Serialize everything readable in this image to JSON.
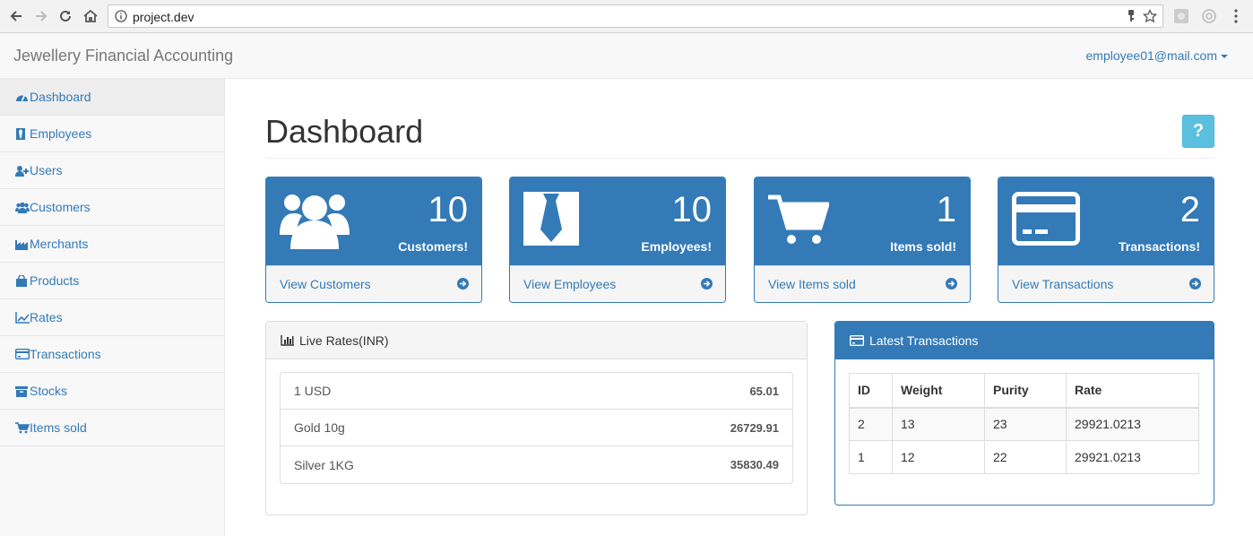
{
  "browser": {
    "url": "project.dev"
  },
  "app": {
    "brand": "Jewellery Financial Accounting",
    "user_email": "employee01@mail.com"
  },
  "sidebar": {
    "items": [
      {
        "label": "Dashboard",
        "icon": "dashboard-icon"
      },
      {
        "label": "Employees",
        "icon": "tie-icon"
      },
      {
        "label": "Users",
        "icon": "user-plus-icon"
      },
      {
        "label": "Customers",
        "icon": "users-icon"
      },
      {
        "label": "Merchants",
        "icon": "industry-icon"
      },
      {
        "label": "Products",
        "icon": "shopping-bag-icon"
      },
      {
        "label": "Rates",
        "icon": "line-chart-icon"
      },
      {
        "label": "Transactions",
        "icon": "credit-card-icon"
      },
      {
        "label": "Stocks",
        "icon": "archive-icon"
      },
      {
        "label": "Items sold",
        "icon": "cart-icon"
      }
    ]
  },
  "main": {
    "title": "Dashboard",
    "help_label": "?"
  },
  "stats": [
    {
      "count": "10",
      "label": "Customers!",
      "link": "View Customers",
      "icon": "users-icon"
    },
    {
      "count": "10",
      "label": "Employees!",
      "link": "View Employees",
      "icon": "tie-icon"
    },
    {
      "count": "1",
      "label": "Items sold!",
      "link": "View Items sold",
      "icon": "cart-icon"
    },
    {
      "count": "2",
      "label": "Transactions!",
      "link": "View Transactions",
      "icon": "credit-card-icon"
    }
  ],
  "rates": {
    "title": "Live Rates(INR)",
    "rows": [
      {
        "name": "1 USD",
        "value": "65.01"
      },
      {
        "name": "Gold 10g",
        "value": "26729.91"
      },
      {
        "name": "Silver 1KG",
        "value": "35830.49"
      }
    ]
  },
  "transactions": {
    "title": "Latest Transactions",
    "columns": [
      "ID",
      "Weight",
      "Purity",
      "Rate"
    ],
    "rows": [
      [
        "2",
        "13",
        "23",
        "29921.0213"
      ],
      [
        "1",
        "12",
        "22",
        "29921.0213"
      ]
    ]
  },
  "colors": {
    "primary": "#337ab7",
    "info": "#5bc0de",
    "sidebar_bg": "#f8f8f8"
  }
}
